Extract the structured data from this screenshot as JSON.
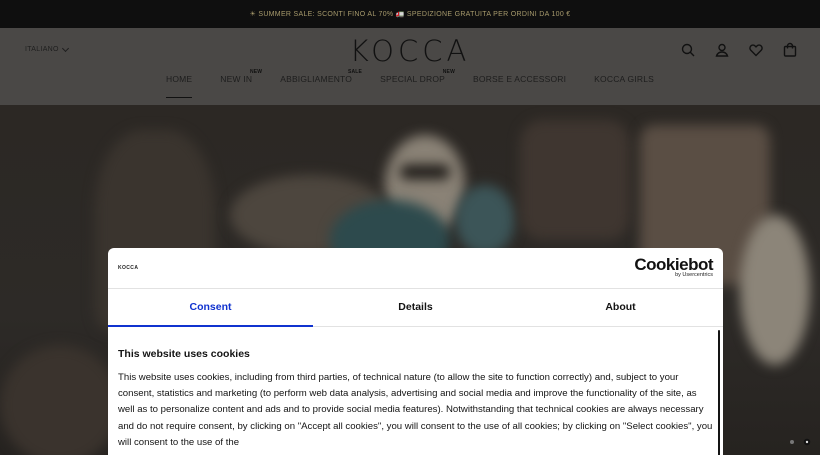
{
  "announcement": {
    "icon": "sun-icon",
    "text": "☀ SUMMER SALE: SCONTI FINO AL 70% 🚛 SPEDIZIONE GRATUITA PER ORDINI DA 100 €"
  },
  "header": {
    "language": "ITALIANO",
    "logo": "KOCCA",
    "nav": [
      {
        "label": "HOME",
        "badge": ""
      },
      {
        "label": "NEW IN",
        "badge": "NEW"
      },
      {
        "label": "ABBIGLIAMENTO",
        "badge": "SALE"
      },
      {
        "label": "SPECIAL DROP",
        "badge": "NEW"
      },
      {
        "label": "BORSE E ACCESSORI",
        "badge": ""
      },
      {
        "label": "KOCCA GIRLS",
        "badge": ""
      }
    ]
  },
  "cookie_dialog": {
    "brand": "KOCCA",
    "provider_logo": "Cookiebot",
    "provider_sub": "by Usercentrics",
    "tabs": [
      "Consent",
      "Details",
      "About"
    ],
    "active_tab": "Consent",
    "title": "This website uses cookies",
    "body": "This website uses cookies, including from third parties, of technical nature (to allow the site to function correctly) and, subject to your consent, statistics and marketing (to perform web data analysis, advertising and social media and improve the functionality of the site, as well as to personalize content and ads and to provide social media features). Notwithstanding that technical cookies are always necessary and do not require consent, by clicking on \"Accept all cookies\", you will consent to the use of all cookies; by clicking on \"Select cookies\", you will consent to the use of the"
  },
  "colors": {
    "accent_tab": "#1032cf",
    "announcement_bg": "#0f0f0f",
    "announcement_text": "#a79a6c"
  }
}
